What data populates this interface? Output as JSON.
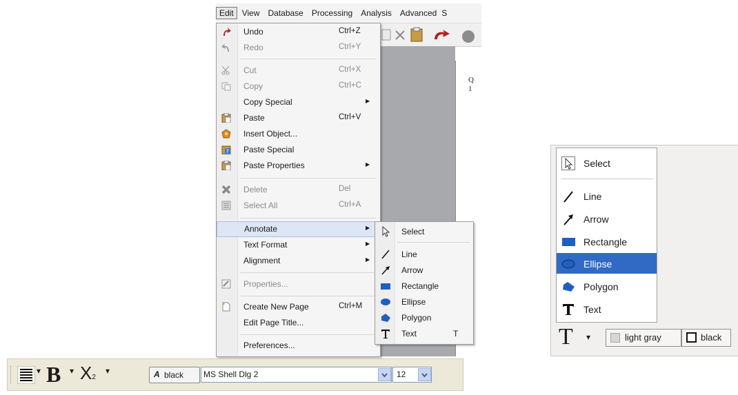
{
  "menubar": {
    "items": [
      "Edit",
      "View",
      "Database",
      "Processing",
      "Analysis",
      "Advanced"
    ],
    "overflow_glyph": "S"
  },
  "document": {
    "line1": "Q",
    "line2": "1"
  },
  "edit_menu": {
    "undo": {
      "label": "Undo",
      "shortcut": "Ctrl+Z"
    },
    "redo": {
      "label": "Redo",
      "shortcut": "Ctrl+Y"
    },
    "cut": {
      "label": "Cut",
      "shortcut": "Ctrl+X"
    },
    "copy": {
      "label": "Copy",
      "shortcut": "Ctrl+C"
    },
    "copy_special": {
      "label": "Copy Special"
    },
    "paste": {
      "label": "Paste",
      "shortcut": "Ctrl+V"
    },
    "insert_object": {
      "label": "Insert Object..."
    },
    "paste_special": {
      "label": "Paste Special"
    },
    "paste_properties": {
      "label": "Paste Properties"
    },
    "delete": {
      "label": "Delete",
      "shortcut": "Del"
    },
    "select_all": {
      "label": "Select All",
      "shortcut": "Ctrl+A"
    },
    "annotate": {
      "label": "Annotate"
    },
    "text_format": {
      "label": "Text Format"
    },
    "alignment": {
      "label": "Alignment"
    },
    "properties": {
      "label": "Properties..."
    },
    "create_new_page": {
      "label": "Create New Page",
      "shortcut": "Ctrl+M"
    },
    "edit_page_title": {
      "label": "Edit Page Title..."
    },
    "preferences": {
      "label": "Preferences..."
    }
  },
  "annotate_submenu": {
    "select": "Select",
    "line": "Line",
    "arrow": "Arrow",
    "rectangle": "Rectangle",
    "ellipse": "Ellipse",
    "polygon": "Polygon",
    "text": "Text",
    "text_shortcut": "T"
  },
  "format_toolbar": {
    "bold_glyph": "B",
    "subscript_glyph": "X",
    "subscript_small": "2",
    "color_label": "black",
    "font_name": "MS Shell Dlg 2",
    "font_size": "12"
  },
  "annotation_dropdown": {
    "items": [
      "Select",
      "Line",
      "Arrow",
      "Rectangle",
      "Ellipse",
      "Polygon",
      "Text"
    ],
    "selected": "Ellipse"
  },
  "annotation_toolbar": {
    "text_tool_glyph": "T",
    "fill_color_label": "light gray",
    "line_color_label": "black"
  },
  "colors": {
    "highlight": "#316ac5",
    "menu_hover": "#dde6f4",
    "undo_red": "#c0392b",
    "shape_blue": "#1f5fbf"
  }
}
